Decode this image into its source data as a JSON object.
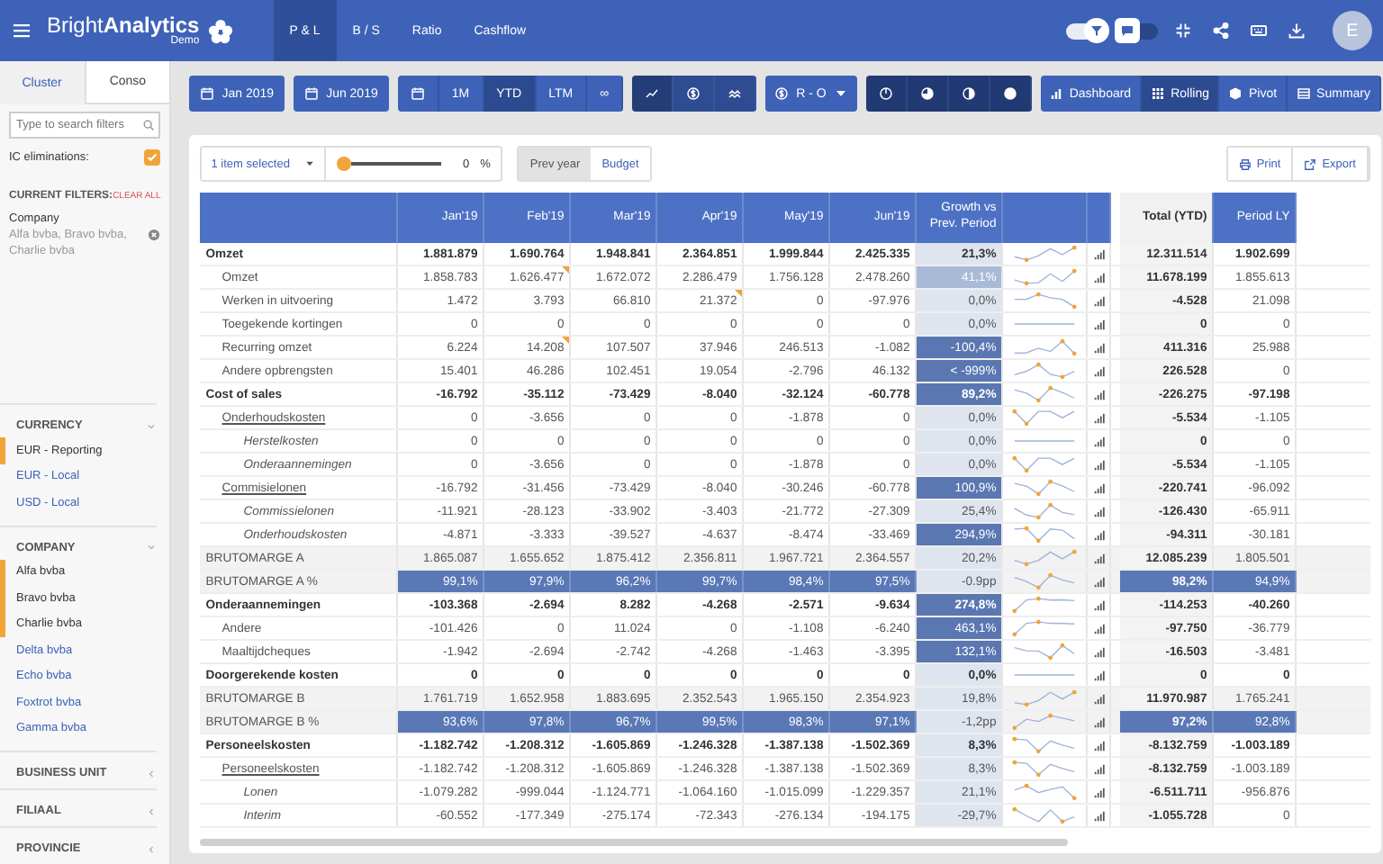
{
  "app": {
    "name": "Bright**Analytics**",
    "subtitle": "Demo"
  },
  "nav_tabs": [
    {
      "label": "P & L",
      "selected": true
    },
    {
      "label": "B / S",
      "selected": false
    },
    {
      "label": "Ratio",
      "selected": false
    },
    {
      "label": "Cashflow",
      "selected": false
    }
  ],
  "header_toggles": [
    {
      "kind": "filter",
      "on": true
    },
    {
      "kind": "chat",
      "on": false
    }
  ],
  "user": {
    "initial": "E"
  },
  "toolbar": {
    "start_date": "Jan 2019",
    "end_date": "Jun 2019",
    "periods": [
      {
        "label": "1M",
        "selected": false
      },
      {
        "label": "YTD",
        "selected": true
      },
      {
        "label": "LTM",
        "selected": false
      },
      {
        "label": "∞",
        "selected": false
      }
    ],
    "chart_modes": [
      {
        "kind": "line",
        "selected": true
      },
      {
        "kind": "dollar",
        "selected": false
      },
      {
        "kind": "trend",
        "selected": false
      }
    ],
    "currency": "R - O",
    "fills": [
      {
        "kind": "power"
      },
      {
        "kind": "quarter"
      },
      {
        "kind": "half"
      },
      {
        "kind": "full"
      }
    ],
    "views": [
      {
        "label": "Dashboard",
        "kind": "bars",
        "selected": false
      },
      {
        "label": "Rolling",
        "kind": "grid",
        "selected": true
      },
      {
        "label": "Pivot",
        "kind": "cube",
        "selected": false
      },
      {
        "label": "Summary",
        "kind": "table",
        "selected": false
      }
    ]
  },
  "sidebar": {
    "tabs": [
      {
        "label": "Cluster",
        "selected": true
      },
      {
        "label": "Conso",
        "selected": false
      }
    ],
    "search": {
      "placeholder": "Type to search filters"
    },
    "ic_eliminations": {
      "label": "IC eliminations:",
      "checked": true
    },
    "current_filters": {
      "title": "CURRENT FILTERS:",
      "clear": "CLEAR ALL",
      "items": [
        {
          "name": "Company",
          "values": "Alfa bvba, Bravo bvba, Charlie bvba"
        }
      ]
    },
    "sections": [
      {
        "title": "CURRENCY",
        "expanded": true,
        "items": [
          {
            "label": "EUR - Reporting",
            "selected": true
          },
          {
            "label": "EUR - Local",
            "selected": false
          },
          {
            "label": "USD - Local",
            "selected": false
          }
        ]
      },
      {
        "title": "COMPANY",
        "expanded": true,
        "items": [
          {
            "label": "Alfa bvba",
            "selected": true
          },
          {
            "label": "Bravo bvba",
            "selected": true
          },
          {
            "label": "Charlie bvba",
            "selected": true
          },
          {
            "label": "Delta bvba",
            "selected": false
          },
          {
            "label": "Echo bvba",
            "selected": false
          },
          {
            "label": "Foxtrot bvba",
            "selected": false
          },
          {
            "label": "Gamma bvba",
            "selected": false
          }
        ]
      },
      {
        "title": "BUSINESS UNIT",
        "expanded": false
      },
      {
        "title": "FILIAAL",
        "expanded": false
      },
      {
        "title": "PROVINCIE",
        "expanded": false
      }
    ]
  },
  "report": {
    "selection": "1 item selected",
    "slider": {
      "level": 0,
      "reading": "0",
      "unit": "%"
    },
    "compare": [
      {
        "label": "Prev year",
        "selected": true
      },
      {
        "label": "Budget",
        "selected": false
      }
    ],
    "actions": [
      {
        "label": "Print",
        "kind": "print"
      },
      {
        "label": "Export",
        "kind": "export"
      }
    ],
    "table": {
      "columns": [
        "Jan'19",
        "Feb'19",
        "Mar'19",
        "Apr'19",
        "May'19",
        "Jun'19"
      ],
      "growth_header": "Growth vs Prev. Period",
      "total_header": "Total (YTD)",
      "ly_header": "Period LY",
      "rows": [
        {
          "kind": "group",
          "label": "Omzet",
          "values": [
            "1.881.879",
            "1.690.764",
            "1.948.841",
            "2.364.851",
            "1.999.844",
            "2.425.335"
          ],
          "comments": [
            false,
            false,
            false,
            false,
            false,
            false
          ],
          "growth": "21,3%",
          "color": "#dfe5ef",
          "total": "12.311.514",
          "ly": "1.902.699"
        },
        {
          "kind": "item",
          "label": "Omzet",
          "values": [
            "1.858.783",
            "1.626.477",
            "1.672.072",
            "2.286.479",
            "1.756.128",
            "2.478.260"
          ],
          "comments": [
            false,
            true,
            false,
            false,
            false,
            false
          ],
          "growth": "41,1%",
          "color": "#a9bad7",
          "total": "11.678.199",
          "ly": "1.855.613"
        },
        {
          "kind": "item",
          "label": "Werken in uitvoering",
          "values": [
            "1.472",
            "3.793",
            "66.810",
            "21.372",
            "0",
            "-97.976"
          ],
          "comments": [
            false,
            false,
            false,
            true,
            false,
            false
          ],
          "growth": "0,0%",
          "color": "#dfe5ef",
          "total": "-4.528",
          "ly": "21.098"
        },
        {
          "kind": "item",
          "label": "Toegekende kortingen",
          "values": [
            "0",
            "0",
            "0",
            "0",
            "0",
            "0"
          ],
          "comments": [
            false,
            false,
            false,
            false,
            false,
            false
          ],
          "growth": "0,0%",
          "color": "#dfe5ef",
          "total": "0",
          "ly": "0"
        },
        {
          "kind": "item",
          "label": "Recurring omzet",
          "values": [
            "6.224",
            "14.208",
            "107.507",
            "37.946",
            "246.513",
            "-1.082"
          ],
          "comments": [
            false,
            true,
            false,
            false,
            false,
            false
          ],
          "growth": "-100,4%",
          "color": "#5a77b2",
          "total": "411.316",
          "ly": "25.988"
        },
        {
          "kind": "item",
          "label": "Andere opbrengsten",
          "values": [
            "15.401",
            "46.286",
            "102.451",
            "19.054",
            "-2.796",
            "46.132"
          ],
          "comments": [
            false,
            false,
            false,
            false,
            false,
            false
          ],
          "growth": "< -999%",
          "color": "#5a77b2",
          "total": "226.528",
          "ly": "0"
        },
        {
          "kind": "group",
          "label": "Cost of sales",
          "values": [
            "-16.792",
            "-35.112",
            "-73.429",
            "-8.040",
            "-32.124",
            "-60.778"
          ],
          "comments": [
            false,
            false,
            false,
            false,
            false,
            false
          ],
          "growth": "89,2%",
          "color": "#5a77b2",
          "total": "-226.275",
          "ly": "-97.198"
        },
        {
          "kind": "link",
          "label": "Onderhoudskosten",
          "values": [
            "0",
            "-3.656",
            "0",
            "0",
            "-1.878",
            "0"
          ],
          "comments": [
            false,
            false,
            false,
            false,
            false,
            false
          ],
          "growth": "0,0%",
          "color": "#dfe5ef",
          "total": "-5.534",
          "ly": "-1.105"
        },
        {
          "kind": "sub",
          "label": "Herstelkosten",
          "values": [
            "0",
            "0",
            "0",
            "0",
            "0",
            "0"
          ],
          "comments": [
            false,
            false,
            false,
            false,
            false,
            false
          ],
          "growth": "0,0%",
          "color": "#dfe5ef",
          "total": "0",
          "ly": "0"
        },
        {
          "kind": "sub",
          "label": "Onderaannemingen",
          "values": [
            "0",
            "-3.656",
            "0",
            "0",
            "-1.878",
            "0"
          ],
          "comments": [
            false,
            false,
            false,
            false,
            false,
            false
          ],
          "growth": "0,0%",
          "color": "#dfe5ef",
          "total": "-5.534",
          "ly": "-1.105"
        },
        {
          "kind": "link",
          "label": "Commisielonen",
          "values": [
            "-16.792",
            "-31.456",
            "-73.429",
            "-8.040",
            "-30.246",
            "-60.778"
          ],
          "comments": [
            false,
            false,
            false,
            false,
            false,
            false
          ],
          "growth": "100,9%",
          "color": "#5a77b2",
          "total": "-220.741",
          "ly": "-96.092"
        },
        {
          "kind": "sub",
          "label": "Commissielonen",
          "values": [
            "-11.921",
            "-28.123",
            "-33.902",
            "-3.403",
            "-21.772",
            "-27.309"
          ],
          "comments": [
            false,
            false,
            false,
            false,
            false,
            false
          ],
          "growth": "25,4%",
          "color": "#dfe5ef",
          "total": "-126.430",
          "ly": "-65.911"
        },
        {
          "kind": "sub",
          "label": "Onderhoudskosten",
          "values": [
            "-4.871",
            "-3.333",
            "-39.527",
            "-4.637",
            "-8.474",
            "-33.469"
          ],
          "comments": [
            false,
            false,
            false,
            false,
            false,
            false
          ],
          "growth": "294,9%",
          "color": "#5a77b2",
          "total": "-94.311",
          "ly": "-30.181"
        },
        {
          "kind": "margin",
          "label": "BRUTOMARGE A",
          "values": [
            "1.865.087",
            "1.655.652",
            "1.875.412",
            "2.356.811",
            "1.967.721",
            "2.364.557"
          ],
          "comments": [
            false,
            false,
            false,
            false,
            false,
            false
          ],
          "growth": "20,2%",
          "color": "#dfe5ef",
          "total": "12.085.239",
          "ly": "1.805.501"
        },
        {
          "kind": "percent",
          "label": "BRUTOMARGE A %",
          "values": [
            "99,1%",
            "97,9%",
            "96,2%",
            "99,7%",
            "98,4%",
            "97,5%"
          ],
          "comments": [
            false,
            false,
            false,
            false,
            false,
            false
          ],
          "growth": "-0.9pp",
          "color": "#dfe5ef",
          "total": "98,2%",
          "ly": "94,9%"
        },
        {
          "kind": "group",
          "label": "Onderaannemingen",
          "values": [
            "-103.368",
            "-2.694",
            "8.282",
            "-4.268",
            "-2.571",
            "-9.634"
          ],
          "comments": [
            false,
            false,
            false,
            false,
            false,
            false
          ],
          "growth": "274,8%",
          "color": "#5a77b2",
          "total": "-114.253",
          "ly": "-40.260"
        },
        {
          "kind": "item",
          "label": "Andere",
          "values": [
            "-101.426",
            "0",
            "11.024",
            "0",
            "-1.108",
            "-6.240"
          ],
          "comments": [
            false,
            false,
            false,
            false,
            false,
            false
          ],
          "growth": "463,1%",
          "color": "#5a77b2",
          "total": "-97.750",
          "ly": "-36.779"
        },
        {
          "kind": "item",
          "label": "Maaltijdcheques",
          "values": [
            "-1.942",
            "-2.694",
            "-2.742",
            "-4.268",
            "-1.463",
            "-3.395"
          ],
          "comments": [
            false,
            false,
            false,
            false,
            false,
            false
          ],
          "growth": "132,1%",
          "color": "#5a77b2",
          "total": "-16.503",
          "ly": "-3.481"
        },
        {
          "kind": "group",
          "label": "Doorgerekende kosten",
          "values": [
            "0",
            "0",
            "0",
            "0",
            "0",
            "0"
          ],
          "comments": [
            false,
            false,
            false,
            false,
            false,
            false
          ],
          "growth": "0,0%",
          "color": "#dfe5ef",
          "total": "0",
          "ly": "0"
        },
        {
          "kind": "margin",
          "label": "BRUTOMARGE B",
          "values": [
            "1.761.719",
            "1.652.958",
            "1.883.695",
            "2.352.543",
            "1.965.150",
            "2.354.923"
          ],
          "comments": [
            false,
            false,
            false,
            false,
            false,
            false
          ],
          "growth": "19,8%",
          "color": "#dfe5ef",
          "total": "11.970.987",
          "ly": "1.765.241"
        },
        {
          "kind": "percent",
          "label": "BRUTOMARGE B %",
          "values": [
            "93,6%",
            "97,8%",
            "96,7%",
            "99,5%",
            "98,3%",
            "97,1%"
          ],
          "comments": [
            false,
            false,
            false,
            false,
            false,
            false
          ],
          "growth": "-1,2pp",
          "color": "#dfe5ef",
          "total": "97,2%",
          "ly": "92,8%"
        },
        {
          "kind": "group",
          "label": "Personeelskosten",
          "values": [
            "-1.182.742",
            "-1.208.312",
            "-1.605.869",
            "-1.246.328",
            "-1.387.138",
            "-1.502.369"
          ],
          "comments": [
            false,
            false,
            false,
            false,
            false,
            false
          ],
          "growth": "8,3%",
          "color": "#dfe5ef",
          "total": "-8.132.759",
          "ly": "-1.003.189"
        },
        {
          "kind": "link",
          "label": "Personeelskosten",
          "values": [
            "-1.182.742",
            "-1.208.312",
            "-1.605.869",
            "-1.246.328",
            "-1.387.138",
            "-1.502.369"
          ],
          "comments": [
            false,
            false,
            false,
            false,
            false,
            false
          ],
          "growth": "8,3%",
          "color": "#dfe5ef",
          "total": "-8.132.759",
          "ly": "-1.003.189"
        },
        {
          "kind": "sub",
          "label": "Lonen",
          "values": [
            "-1.079.282",
            "-999.044",
            "-1.124.771",
            "-1.064.160",
            "-1.015.099",
            "-1.229.357"
          ],
          "comments": [
            false,
            false,
            false,
            false,
            false,
            false
          ],
          "growth": "21,1%",
          "color": "#dfe5ef",
          "total": "-6.511.711",
          "ly": "-956.876"
        },
        {
          "kind": "sub",
          "label": "Interim",
          "values": [
            "-60.552",
            "-177.349",
            "-275.174",
            "-72.343",
            "-276.134",
            "-194.175"
          ],
          "comments": [
            false,
            false,
            false,
            false,
            false,
            false
          ],
          "growth": "-29,7%",
          "color": "#dfe5ef",
          "total": "-1.055.728",
          "ly": "0"
        }
      ]
    }
  }
}
